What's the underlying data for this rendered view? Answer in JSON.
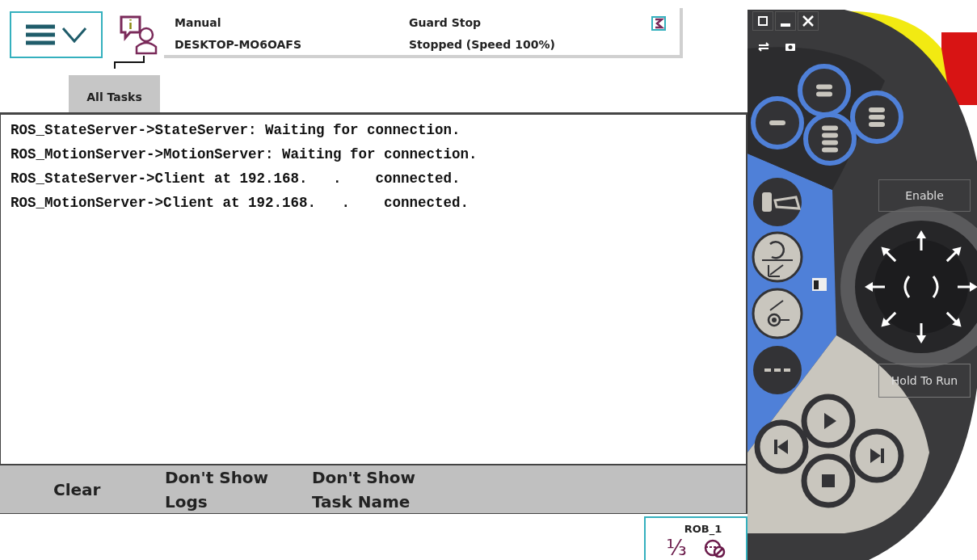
{
  "status": {
    "mode": "Manual",
    "controller": "DESKTOP-MO6OAFS",
    "state": "Guard Stop",
    "speed_state": "Stopped (Speed 100%)"
  },
  "tabs": [
    {
      "label": "All Tasks",
      "selected": true
    }
  ],
  "log_lines": [
    "ROS_StateServer->StateServer: Waiting for connection.",
    "ROS_MotionServer->MotionServer: Waiting for connection.",
    "ROS_StateServer->Client at 192.168.   .    connected.",
    "ROS_MotionServer->Client at 192.168.   .    connected."
  ],
  "toolbar": [
    "Clear",
    "Don't Show Logs",
    "Don't Show Task Name"
  ],
  "task_indicator": {
    "task": "ROB_1",
    "fraction": "⅓"
  },
  "pendant": {
    "enable_label": "Enable",
    "hold_to_run_label": "Hold To Run"
  }
}
